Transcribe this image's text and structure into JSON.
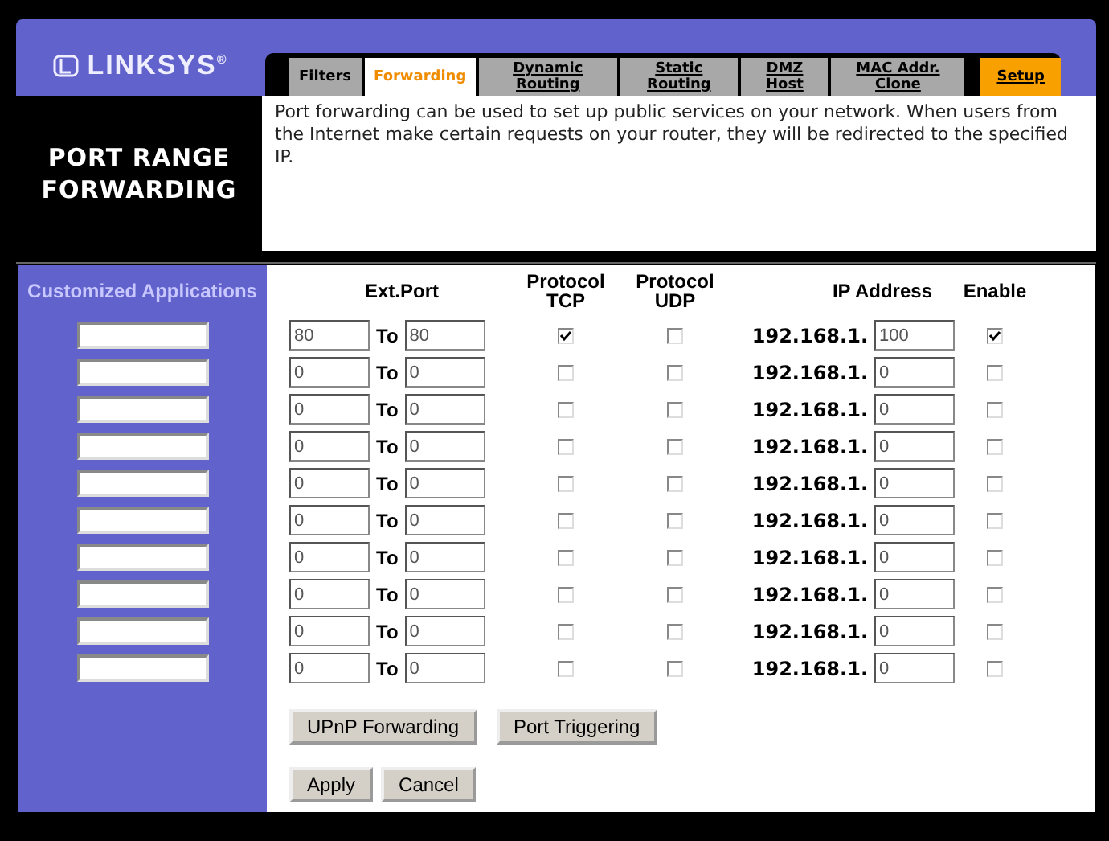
{
  "header": {
    "logo": "LINKSYS",
    "logo_mark": "®"
  },
  "tabs": [
    {
      "label": "Filters",
      "selected": false,
      "kind": "plain"
    },
    {
      "label": "Forwarding",
      "selected": true,
      "kind": "plain"
    },
    {
      "label": "Dynamic Routing",
      "selected": false,
      "kind": "link"
    },
    {
      "label": "Static Routing",
      "selected": false,
      "kind": "link"
    },
    {
      "label": "DMZ Host",
      "selected": false,
      "kind": "link"
    },
    {
      "label": "MAC Addr. Clone",
      "selected": false,
      "kind": "link"
    },
    {
      "label": "Setup",
      "selected": false,
      "kind": "setup"
    }
  ],
  "page_title": "PORT RANGE FORWARDING",
  "description": "Port forwarding can be used to set up public services on your network. When users from the Internet make certain requests on your router, they will be redirected to the specified IP.",
  "table": {
    "columns": [
      "Customized Applications",
      "Ext.Port",
      "Protocol TCP",
      "Protocol UDP",
      "IP Address",
      "Enable"
    ],
    "rows": [
      {
        "port_from": "80",
        "to": "To",
        "port_to": "80",
        "tcp": true,
        "udp": false,
        "ip_prefix": "192.168.1.",
        "ip_last": "100",
        "enable": true
      },
      {
        "port_from": "0",
        "to": "To",
        "port_to": "0",
        "tcp": false,
        "udp": false,
        "ip_prefix": "192.168.1.",
        "ip_last": "0",
        "enable": false
      },
      {
        "port_from": "0",
        "to": "To",
        "port_to": "0",
        "tcp": false,
        "udp": false,
        "ip_prefix": "192.168.1.",
        "ip_last": "0",
        "enable": false
      },
      {
        "port_from": "0",
        "to": "To",
        "port_to": "0",
        "tcp": false,
        "udp": false,
        "ip_prefix": "192.168.1.",
        "ip_last": "0",
        "enable": false
      },
      {
        "port_from": "0",
        "to": "To",
        "port_to": "0",
        "tcp": false,
        "udp": false,
        "ip_prefix": "192.168.1.",
        "ip_last": "0",
        "enable": false
      },
      {
        "port_from": "0",
        "to": "To",
        "port_to": "0",
        "tcp": false,
        "udp": false,
        "ip_prefix": "192.168.1.",
        "ip_last": "0",
        "enable": false
      },
      {
        "port_from": "0",
        "to": "To",
        "port_to": "0",
        "tcp": false,
        "udp": false,
        "ip_prefix": "192.168.1.",
        "ip_last": "0",
        "enable": false
      },
      {
        "port_from": "0",
        "to": "To",
        "port_to": "0",
        "tcp": false,
        "udp": false,
        "ip_prefix": "192.168.1.",
        "ip_last": "0",
        "enable": false
      },
      {
        "port_from": "0",
        "to": "To",
        "port_to": "0",
        "tcp": false,
        "udp": false,
        "ip_prefix": "192.168.1.",
        "ip_last": "0",
        "enable": false
      },
      {
        "port_from": "0",
        "to": "To",
        "port_to": "0",
        "tcp": false,
        "udp": false,
        "ip_prefix": "192.168.1.",
        "ip_last": "0",
        "enable": false
      }
    ]
  },
  "nav_buttons": [
    "UPnP Forwarding",
    "Port Triggering"
  ],
  "action_buttons": [
    "Apply",
    "Cancel"
  ]
}
